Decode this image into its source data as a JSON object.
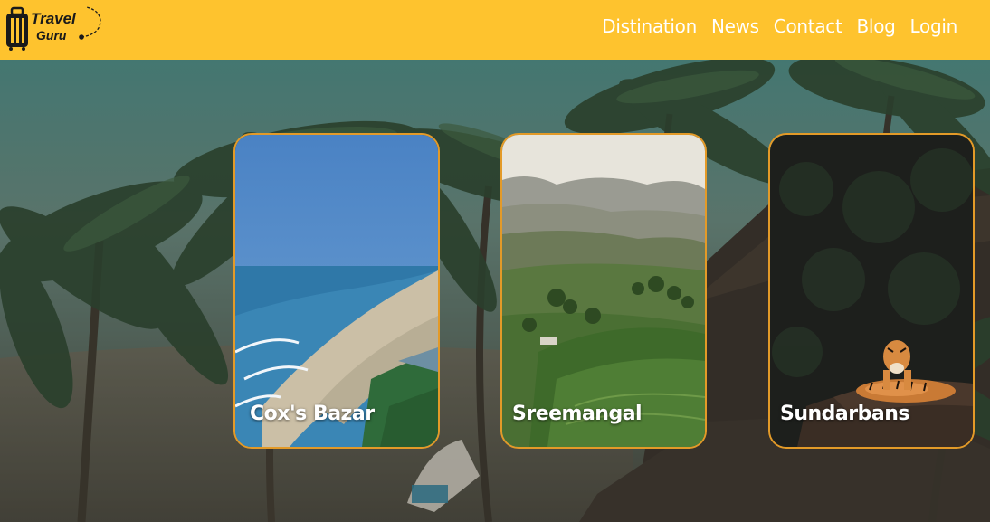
{
  "brand": {
    "line1": "Travel",
    "line2": "Guru",
    "icon": "suitcase-icon"
  },
  "nav": {
    "items": [
      {
        "label": "Distination"
      },
      {
        "label": "News"
      },
      {
        "label": "Contact"
      },
      {
        "label": "Blog"
      },
      {
        "label": "Login"
      }
    ]
  },
  "destinations": [
    {
      "title": "Cox's Bazar",
      "image": "beach-coastline-photo"
    },
    {
      "title": "Sreemangal",
      "image": "tea-garden-hills-photo"
    },
    {
      "title": "Sundarbans",
      "image": "tiger-forest-photo"
    }
  ],
  "colors": {
    "navbar": "#fec32e",
    "card_border": "#e39a28",
    "nav_text": "#ffffff"
  }
}
